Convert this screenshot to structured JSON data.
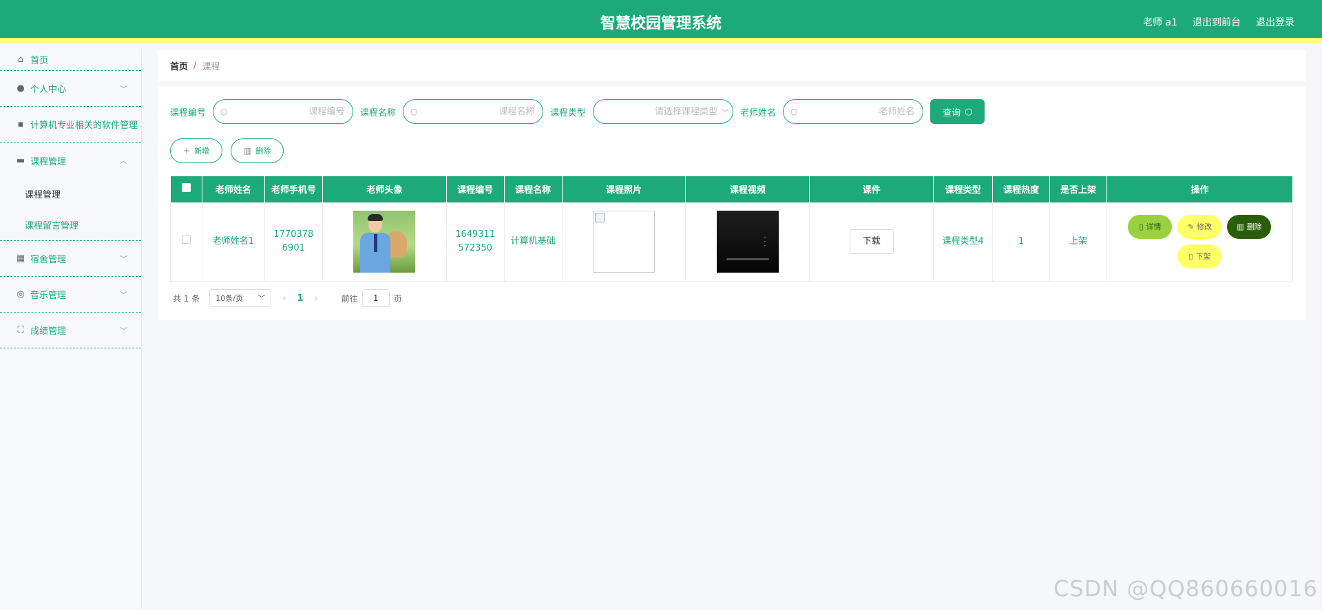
{
  "header": {
    "title": "智慧校园管理系统",
    "user": "老师 a1",
    "to_front": "退出到前台",
    "logout": "退出登录"
  },
  "sidebar": {
    "items": [
      {
        "label": "首页",
        "icon": "home-icon"
      },
      {
        "label": "个人中心",
        "icon": "user-icon"
      },
      {
        "label": "计算机专业相关的软件管理",
        "icon": "message-icon"
      },
      {
        "label": "课程管理",
        "icon": "briefcase-icon"
      },
      {
        "label": "宿舍管理",
        "icon": "grid-icon"
      },
      {
        "label": "音乐管理",
        "icon": "compass-icon"
      },
      {
        "label": "成绩管理",
        "icon": "fullscreen-icon"
      }
    ],
    "sub_items": [
      "课程管理",
      "课程留言管理"
    ]
  },
  "breadcrumb": {
    "home": "首页",
    "separator": "/",
    "current": "课程"
  },
  "search": {
    "course_no_label": "课程编号",
    "course_no_placeholder": "课程编号",
    "course_name_label": "课程名称",
    "course_name_placeholder": "课程名称",
    "course_type_label": "课程类型",
    "course_type_placeholder": "请选择课程类型",
    "teacher_label": "老师姓名",
    "teacher_placeholder": "老师姓名",
    "query_label": "查询"
  },
  "actions": {
    "add": "新增",
    "delete": "删除"
  },
  "table": {
    "headers": [
      "老师姓名",
      "老师手机号",
      "老师头像",
      "课程编号",
      "课程名称",
      "课程照片",
      "课程视频",
      "课件",
      "课程类型",
      "课程热度",
      "是否上架",
      "操作"
    ],
    "rows": [
      {
        "teacher_name": "老师姓名1",
        "phone": "17703786901",
        "course_no": "1649311572350",
        "course_name": "计算机基础",
        "download": "下载",
        "course_type": "课程类型4",
        "heat": "1",
        "on_shelf": "上架",
        "ops": {
          "detail": "详情",
          "edit": "修改",
          "delete": "删除",
          "off_shelf": "下架"
        }
      }
    ]
  },
  "pager": {
    "total": "共 1 条",
    "page_size": "10条/页",
    "current_page": "1",
    "goto_label": "前往",
    "goto_value": "1",
    "page_suffix": "页"
  },
  "watermark": "CSDN @QQ860660016",
  "colors": {
    "primary": "#1daa7b",
    "accent_stripe": "#ffff80",
    "detail": "#9ad13e",
    "edit": "#ffff66",
    "delete": "#2a5d0b"
  }
}
